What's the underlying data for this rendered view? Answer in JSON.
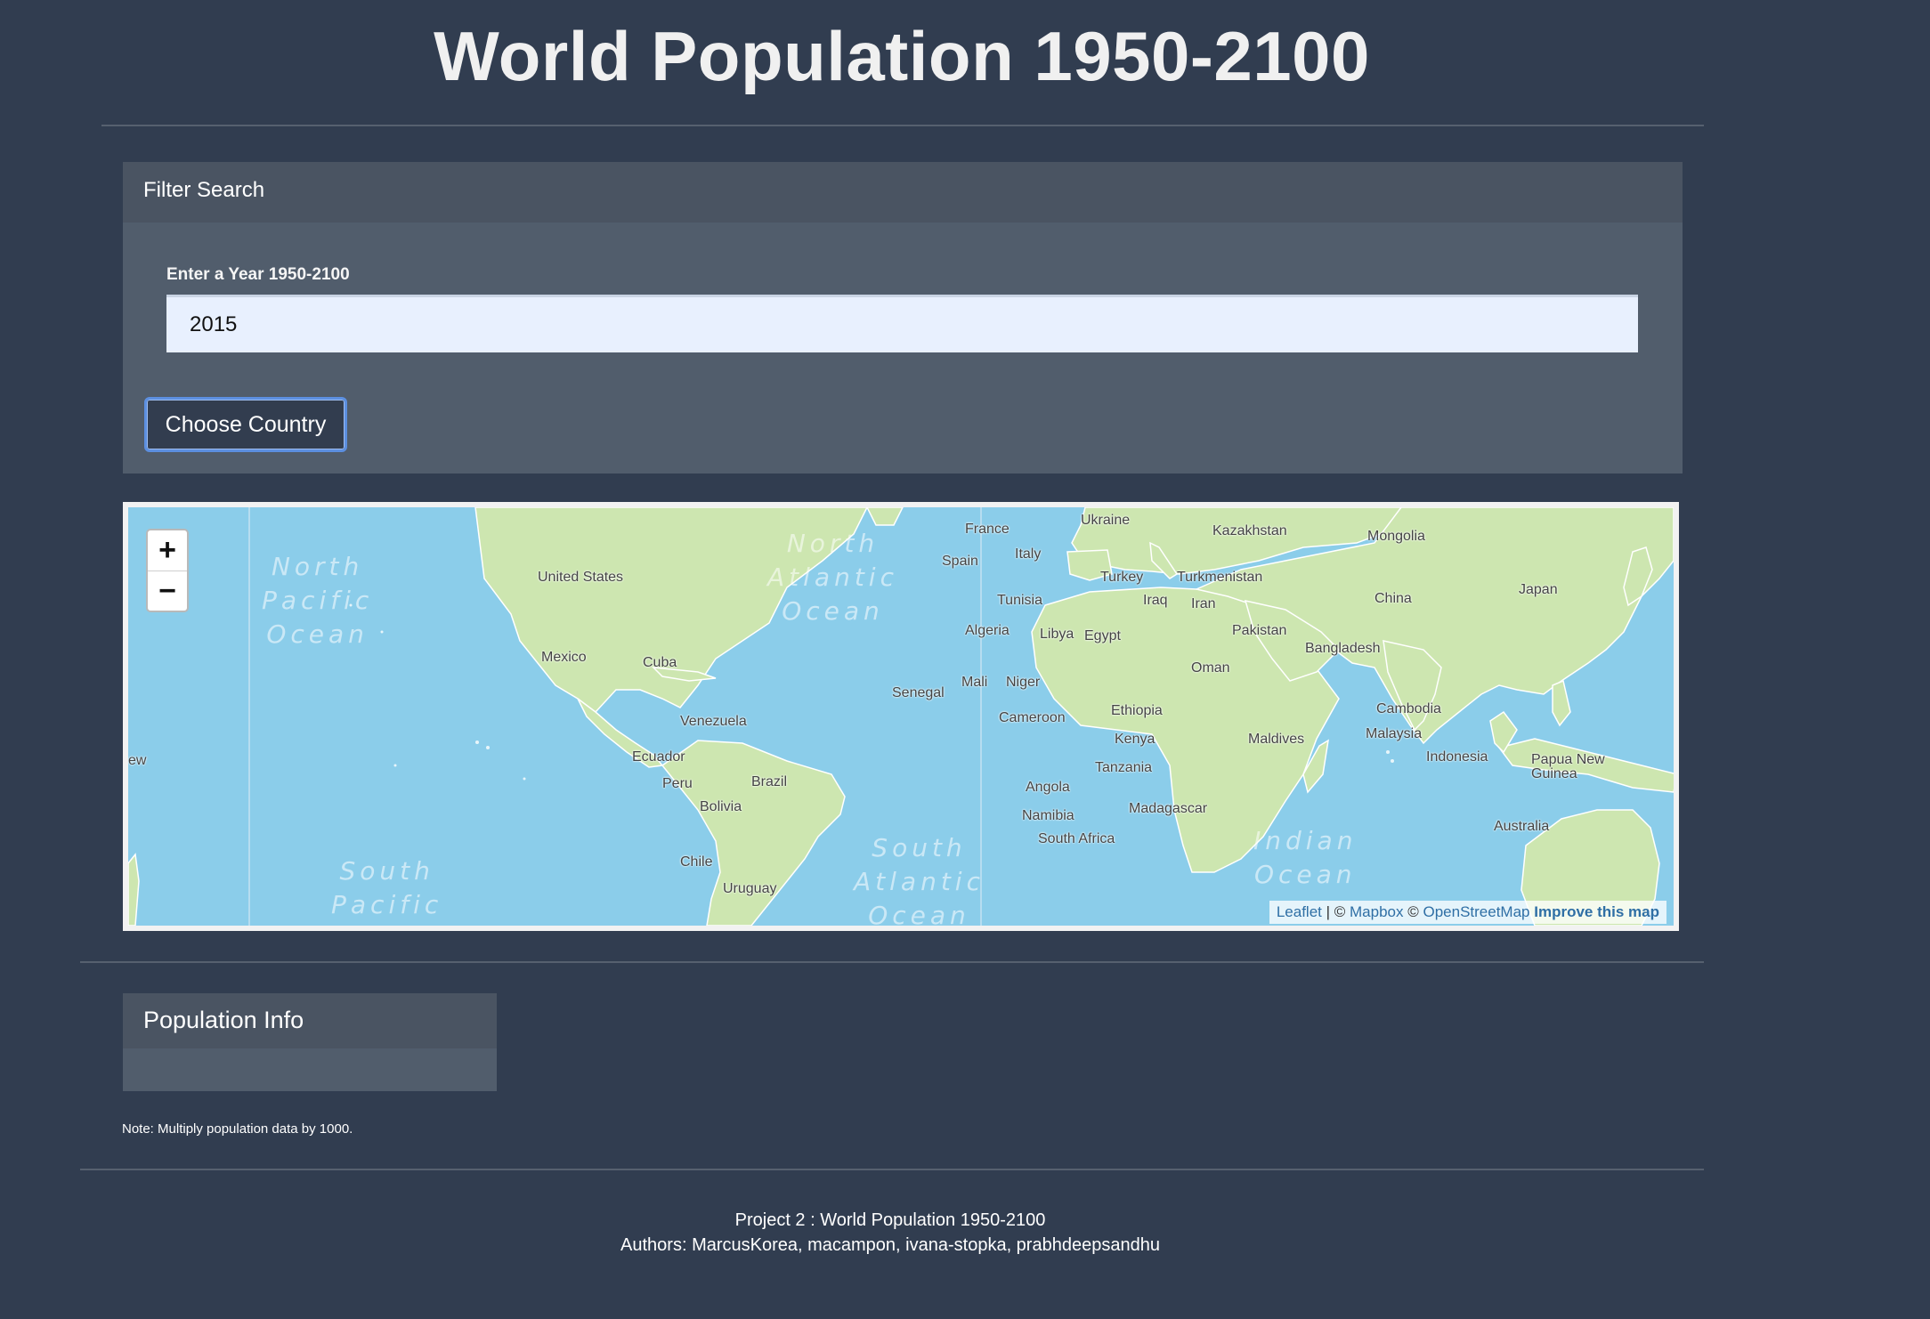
{
  "page": {
    "title": "World Population 1950-2100"
  },
  "filter": {
    "heading": "Filter Search",
    "year_label": "Enter a Year 1950-2100",
    "year_value": "2015",
    "button_label": "Choose Country"
  },
  "map": {
    "zoom_in": "+",
    "zoom_out": "−",
    "attribution": {
      "leaflet": "Leaflet",
      "sep1": " | © ",
      "mapbox": "Mapbox",
      "sep2": " © ",
      "osm": "OpenStreetMap",
      "improve": "Improve this map"
    },
    "oceans": {
      "north_pacific": "North\nPacific\nOcean",
      "north_atlantic": "North\nAtlantic\nOcean",
      "south_pacific": "South\nPacific",
      "south_atlantic": "South\nAtlantic\nOcean",
      "indian": "Indian\nOcean"
    },
    "countries": {
      "usa": "United States",
      "mexico": "Mexico",
      "cuba": "Cuba",
      "venezuela": "Venezuela",
      "ecuador": "Ecuador",
      "peru": "Peru",
      "brazil": "Brazil",
      "bolivia": "Bolivia",
      "chile": "Chile",
      "uruguay": "Uruguay",
      "france": "France",
      "spain": "Spain",
      "italy": "Italy",
      "ukraine": "Ukraine",
      "kazakhstan": "Kazakhstan",
      "mongolia": "Mongolia",
      "turkey": "Turkey",
      "turkmenistan": "Turkmenistan",
      "iraq": "Iraq",
      "iran": "Iran",
      "china": "China",
      "japan": "Japan",
      "tunisia": "Tunisia",
      "algeria": "Algeria",
      "libya": "Libya",
      "egypt": "Egypt",
      "pakistan": "Pakistan",
      "oman": "Oman",
      "bangladesh": "Bangladesh",
      "senegal": "Senegal",
      "mali": "Mali",
      "niger": "Niger",
      "ethiopia": "Ethiopia",
      "cameroon": "Cameroon",
      "kenya": "Kenya",
      "tanzania": "Tanzania",
      "angola": "Angola",
      "namibia": "Namibia",
      "south_africa": "South Africa",
      "madagascar": "Madagascar",
      "maldives": "Maldives",
      "cambodia": "Cambodia",
      "malaysia": "Malaysia",
      "indonesia": "Indonesia",
      "papua": "Papua New\nGuinea",
      "australia": "Australia",
      "new_edge": "ew"
    }
  },
  "population_info": {
    "heading": "Population Info",
    "note": "Note: Multiply population data by 1000."
  },
  "footer": {
    "line1": "Project 2 : World Population 1950-2100",
    "line2": "Authors: MarcusKorea, macampon, ivana-stopka, prabhdeepsandhu"
  },
  "colors": {
    "background": "#313d50",
    "panel_head": "#4a5462",
    "panel_body": "#515d6c",
    "ocean": "#8bcdea",
    "land": "#cde6b0",
    "button_border": "#5c8fe0"
  }
}
